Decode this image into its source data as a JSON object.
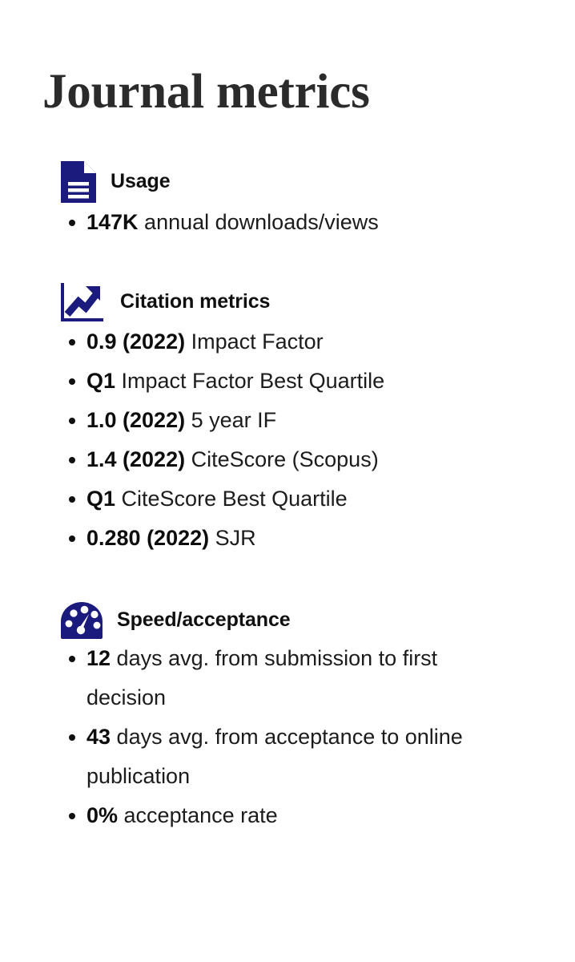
{
  "page": {
    "title": "Journal metrics",
    "accent_color": "#1b1b7e",
    "title_color": "#2b2b2b",
    "text_color": "#1c1c1c",
    "background": "#ffffff"
  },
  "sections": [
    {
      "id": "usage",
      "title": "Usage",
      "icon": "document-icon",
      "items": [
        {
          "value": "147K",
          "label": " annual downloads/views"
        }
      ]
    },
    {
      "id": "citation-metrics",
      "title": "Citation metrics",
      "icon": "chart-up-icon",
      "items": [
        {
          "value": "0.9 (2022)",
          "label": " Impact Factor"
        },
        {
          "value": "Q1",
          "label": " Impact Factor Best Quartile"
        },
        {
          "value": "1.0 (2022)",
          "label": " 5 year IF"
        },
        {
          "value": "1.4 (2022)",
          "label": " CiteScore (Scopus)"
        },
        {
          "value": "Q1",
          "label": " CiteScore Best Quartile"
        },
        {
          "value": "0.280 (2022)",
          "label": " SJR"
        }
      ]
    },
    {
      "id": "speed-acceptance",
      "title": "Speed/acceptance",
      "icon": "speedometer-icon",
      "items": [
        {
          "value": "12",
          "label": " days avg. from submission to first decision"
        },
        {
          "value": "43",
          "label": " days avg. from acceptance to online publication"
        },
        {
          "value": "0%",
          "label": " acceptance rate"
        }
      ]
    }
  ]
}
